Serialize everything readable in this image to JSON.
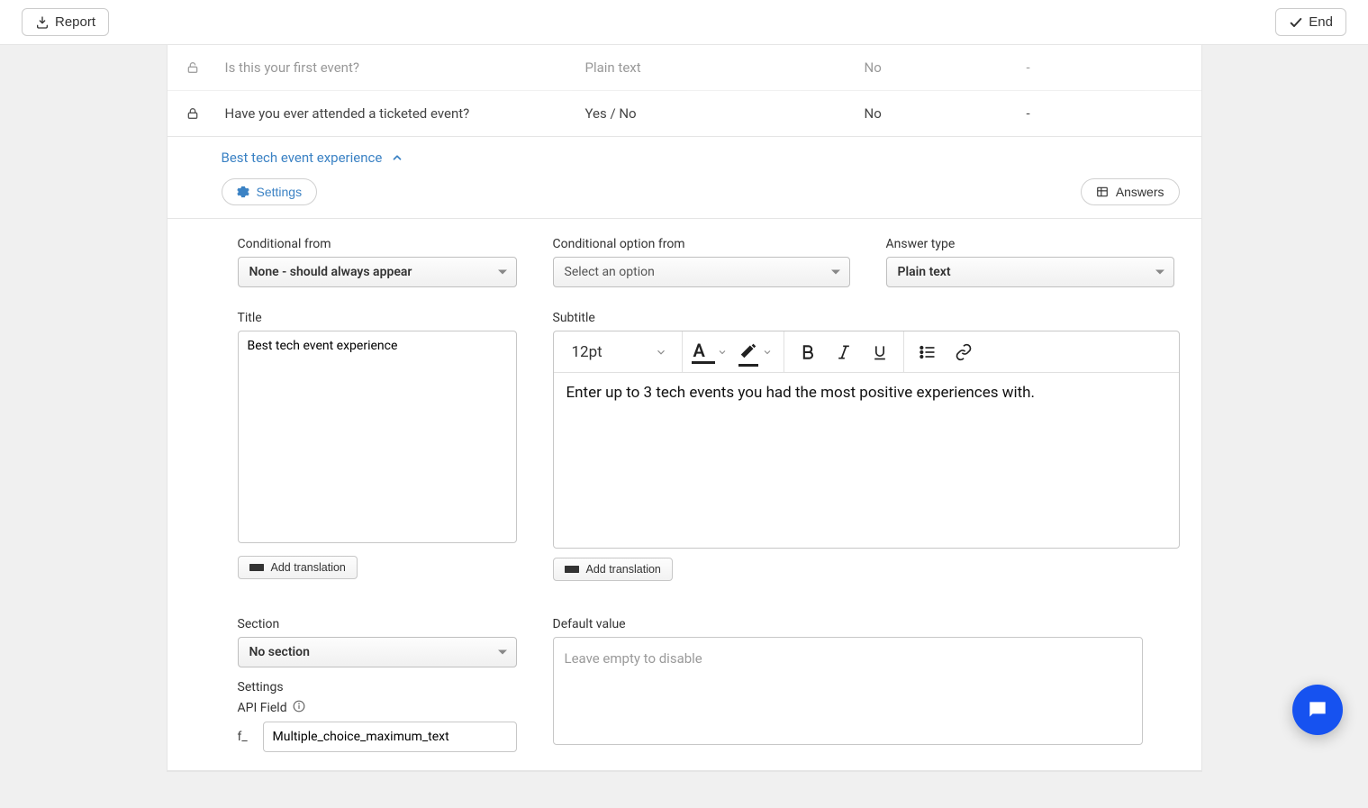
{
  "topbar": {
    "report_label": "Report",
    "end_label": "End"
  },
  "rows": [
    {
      "title": "Is this your first event?",
      "type": "Plain text",
      "required": "No",
      "extra": "-"
    },
    {
      "title": "Have you ever attended a ticketed event?",
      "type": "Yes / No",
      "required": "No",
      "extra": "-"
    }
  ],
  "expanded": {
    "header_title": "Best tech event experience",
    "settings_label": "Settings",
    "answers_label": "Answers",
    "conditional_from_label": "Conditional from",
    "conditional_from_value": "None - should always appear",
    "conditional_option_label": "Conditional option from",
    "conditional_option_value": "Select an option",
    "answer_type_label": "Answer type",
    "answer_type_value": "Plain text",
    "title_label": "Title",
    "title_value": "Best tech event experience",
    "subtitle_label": "Subtitle",
    "font_size": "12pt",
    "subtitle_body": "Enter up to 3 tech events you had the most positive experiences with.",
    "add_translation": "Add translation",
    "section_label": "Section",
    "section_value": "No section",
    "settings_heading": "Settings",
    "api_field_label": "API Field",
    "api_prefix": "f_",
    "api_value": "Multiple_choice_maximum_text",
    "default_label": "Default value",
    "default_placeholder": "Leave empty to disable"
  }
}
